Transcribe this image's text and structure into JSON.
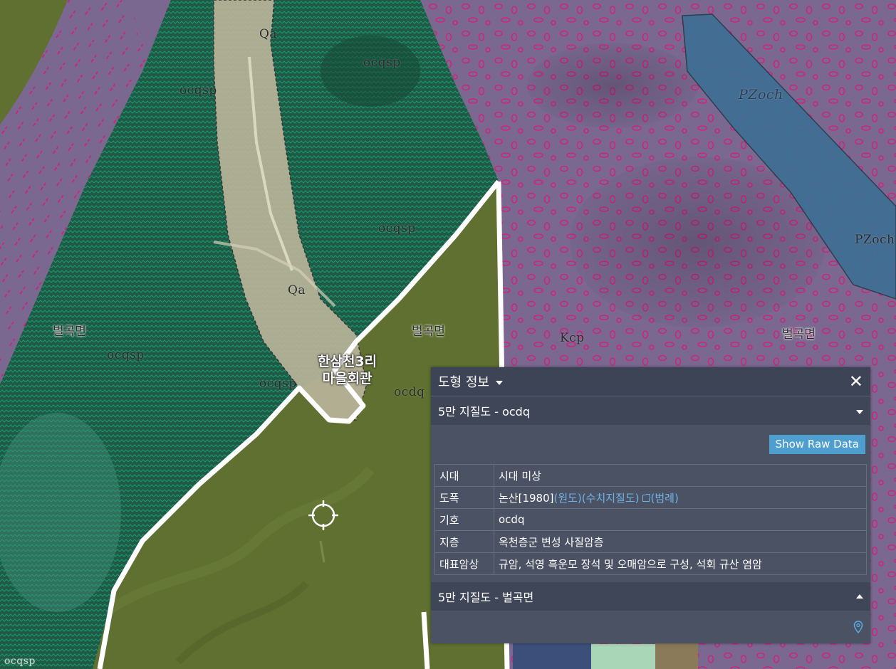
{
  "map": {
    "unit_labels": [
      {
        "text": "Qa"
      },
      {
        "text": "ocqsp"
      },
      {
        "text": "ocqsp"
      },
      {
        "text": "ocqsp"
      },
      {
        "text": "Qa"
      },
      {
        "text": "ocqsp"
      },
      {
        "text": "ocqsp"
      },
      {
        "text": "ocdq"
      },
      {
        "text": "Kcp"
      },
      {
        "text": "PZoch"
      },
      {
        "text": "PZoch"
      },
      {
        "text": "ocqsp"
      }
    ],
    "place_labels": [
      "벌곡면",
      "벌곡면",
      "벌곡면"
    ],
    "landmark": {
      "line1": "한삼천3리",
      "line2": "마을회관"
    },
    "colors": {
      "forest_green": "#1f5a45",
      "green_hatch": "#1aa07a",
      "pink_zone": "#7a6890",
      "pink_mark": "#d81b78",
      "blue_band": "#3e6f94",
      "alluvium": "#b9b49a",
      "olive": "#5f7030",
      "boundary_white": "#ffffff"
    }
  },
  "panel": {
    "title": "도형 정보",
    "close_label": "✕",
    "layer1_label": "5만 지질도 - ocdq",
    "raw_button": "Show Raw Data",
    "rows": {
      "era": {
        "key": "시대",
        "value": "시대 미상"
      },
      "sheet": {
        "key": "도폭",
        "value": "논산[1980]",
        "link1": "(원도)",
        "link2": "(수치지질도)",
        "link3": "(범례)"
      },
      "symbol": {
        "key": "기호",
        "value": "ocdq"
      },
      "strata": {
        "key": "지층",
        "value": "옥천층군 변성 사질암층"
      },
      "lithology": {
        "key": "대표암상",
        "value": "규암, 석영 흑운모 장석 및 오매암으로 구성, 석회 규산 염암"
      }
    },
    "layer2_label": "5만 지질도 - 벌곡면",
    "icons": [
      "chevron-down-icon",
      "close-icon",
      "external-link-icon",
      "chevron-up-icon",
      "map-pin-icon",
      "crosshair-icon"
    ]
  }
}
